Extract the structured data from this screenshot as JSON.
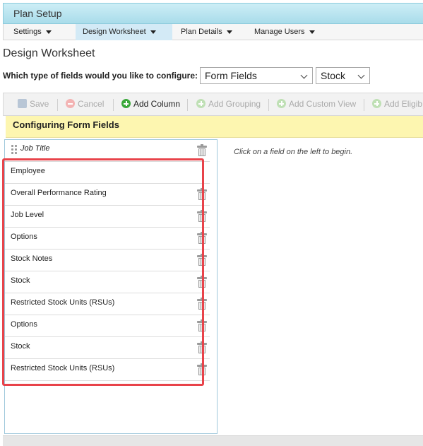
{
  "header": {
    "title": "Plan Setup"
  },
  "nav": {
    "tabs": [
      {
        "label": "Settings",
        "active": false
      },
      {
        "label": "Design Worksheet",
        "active": true
      },
      {
        "label": "Plan Details",
        "active": false
      },
      {
        "label": "Manage Users",
        "active": false
      }
    ]
  },
  "page": {
    "title": "Design Worksheet"
  },
  "config": {
    "question": "Which type of fields would you like to configure:",
    "field_type_value": "Form Fields",
    "sub_type_value": "Stock"
  },
  "toolbar": {
    "save": "Save",
    "cancel": "Cancel",
    "add_column": "Add Column",
    "add_grouping": "Add Grouping",
    "add_custom_view": "Add Custom View",
    "add_eligibility": "Add Eligib"
  },
  "section": {
    "title": "Configuring Form Fields"
  },
  "fields": [
    "Job Title",
    "Employee",
    "Overall Performance Rating",
    "Job Level",
    "Options",
    "Stock Notes",
    "Stock",
    "Restricted Stock Units (RSUs)",
    "Options",
    "Stock",
    "Restricted Stock Units (RSUs)"
  ],
  "right_panel": {
    "message": "Click on a field on the left to begin."
  },
  "colors": {
    "highlight": "#e8434a",
    "header_bg": "#a9dcea",
    "section_bg": "#fdf6b0"
  },
  "icons": {
    "delete": "trash-icon",
    "drag": "drag-handle-icon",
    "add": "plus-circle-icon",
    "cancel": "cancel-icon",
    "save": "save-icon"
  }
}
